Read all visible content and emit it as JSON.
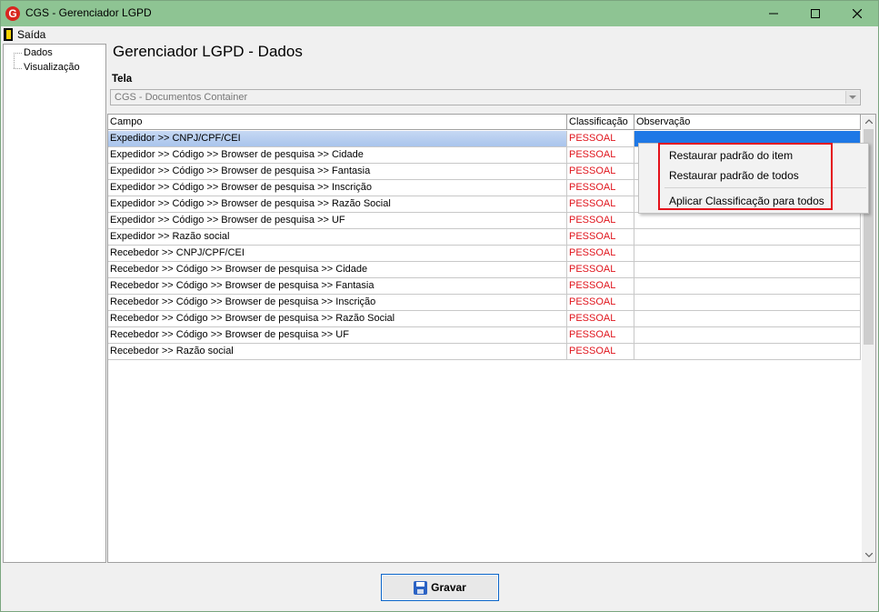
{
  "window": {
    "title": "CGS - Gerenciador LGPD",
    "icon": "cgs-logo-icon",
    "controls": [
      "minimize-icon",
      "maximize-icon",
      "close-icon"
    ]
  },
  "menu": {
    "items": [
      {
        "label": "Saída",
        "icon": "exit-door-icon"
      }
    ]
  },
  "tree": {
    "items": [
      {
        "label": "Dados"
      },
      {
        "label": "Visualização"
      }
    ]
  },
  "page": {
    "title": "Gerenciador LGPD - Dados",
    "tela_label": "Tela",
    "tela_value": "CGS - Documentos Container"
  },
  "grid": {
    "columns": [
      "Campo",
      "Classificação",
      "Observação"
    ],
    "rows": [
      {
        "campo": "Expedidor >> CNPJ/CPF/CEI",
        "classificacao": "PESSOAL",
        "observacao": "",
        "selected": true
      },
      {
        "campo": "Expedidor >> Código >> Browser de pesquisa >> Cidade",
        "classificacao": "PESSOAL",
        "observacao": ""
      },
      {
        "campo": "Expedidor >> Código >> Browser de pesquisa >> Fantasia",
        "classificacao": "PESSOAL",
        "observacao": ""
      },
      {
        "campo": "Expedidor >> Código >> Browser de pesquisa >> Inscrição",
        "classificacao": "PESSOAL",
        "observacao": ""
      },
      {
        "campo": "Expedidor >> Código >> Browser de pesquisa >> Razão Social",
        "classificacao": "PESSOAL",
        "observacao": ""
      },
      {
        "campo": "Expedidor >> Código >> Browser de pesquisa >> UF",
        "classificacao": "PESSOAL",
        "observacao": ""
      },
      {
        "campo": "Expedidor >> Razão social",
        "classificacao": "PESSOAL",
        "observacao": ""
      },
      {
        "campo": "Recebedor >> CNPJ/CPF/CEI",
        "classificacao": "PESSOAL",
        "observacao": ""
      },
      {
        "campo": "Recebedor >> Código >> Browser de pesquisa >> Cidade",
        "classificacao": "PESSOAL",
        "observacao": ""
      },
      {
        "campo": "Recebedor >> Código >> Browser de pesquisa >> Fantasia",
        "classificacao": "PESSOAL",
        "observacao": ""
      },
      {
        "campo": "Recebedor >> Código >> Browser de pesquisa >> Inscrição",
        "classificacao": "PESSOAL",
        "observacao": ""
      },
      {
        "campo": "Recebedor >> Código >> Browser de pesquisa >> Razão Social",
        "classificacao": "PESSOAL",
        "observacao": ""
      },
      {
        "campo": "Recebedor >> Código >> Browser de pesquisa >> UF",
        "classificacao": "PESSOAL",
        "observacao": ""
      },
      {
        "campo": "Recebedor >> Razão social",
        "classificacao": "PESSOAL",
        "observacao": ""
      }
    ]
  },
  "context_menu": {
    "items": [
      {
        "label": "Restaurar padrão do item"
      },
      {
        "label": "Restaurar padrão de todos"
      },
      {
        "label": "Aplicar Classificação para todos"
      }
    ]
  },
  "footer": {
    "save_button": {
      "label": "Gravar",
      "icon": "floppy-disk-icon"
    }
  },
  "colors": {
    "titlebar": "#8ec493",
    "classificacao_text": "#e0151d",
    "selection": "#1e78e6",
    "highlight_box": "#e4121b"
  }
}
